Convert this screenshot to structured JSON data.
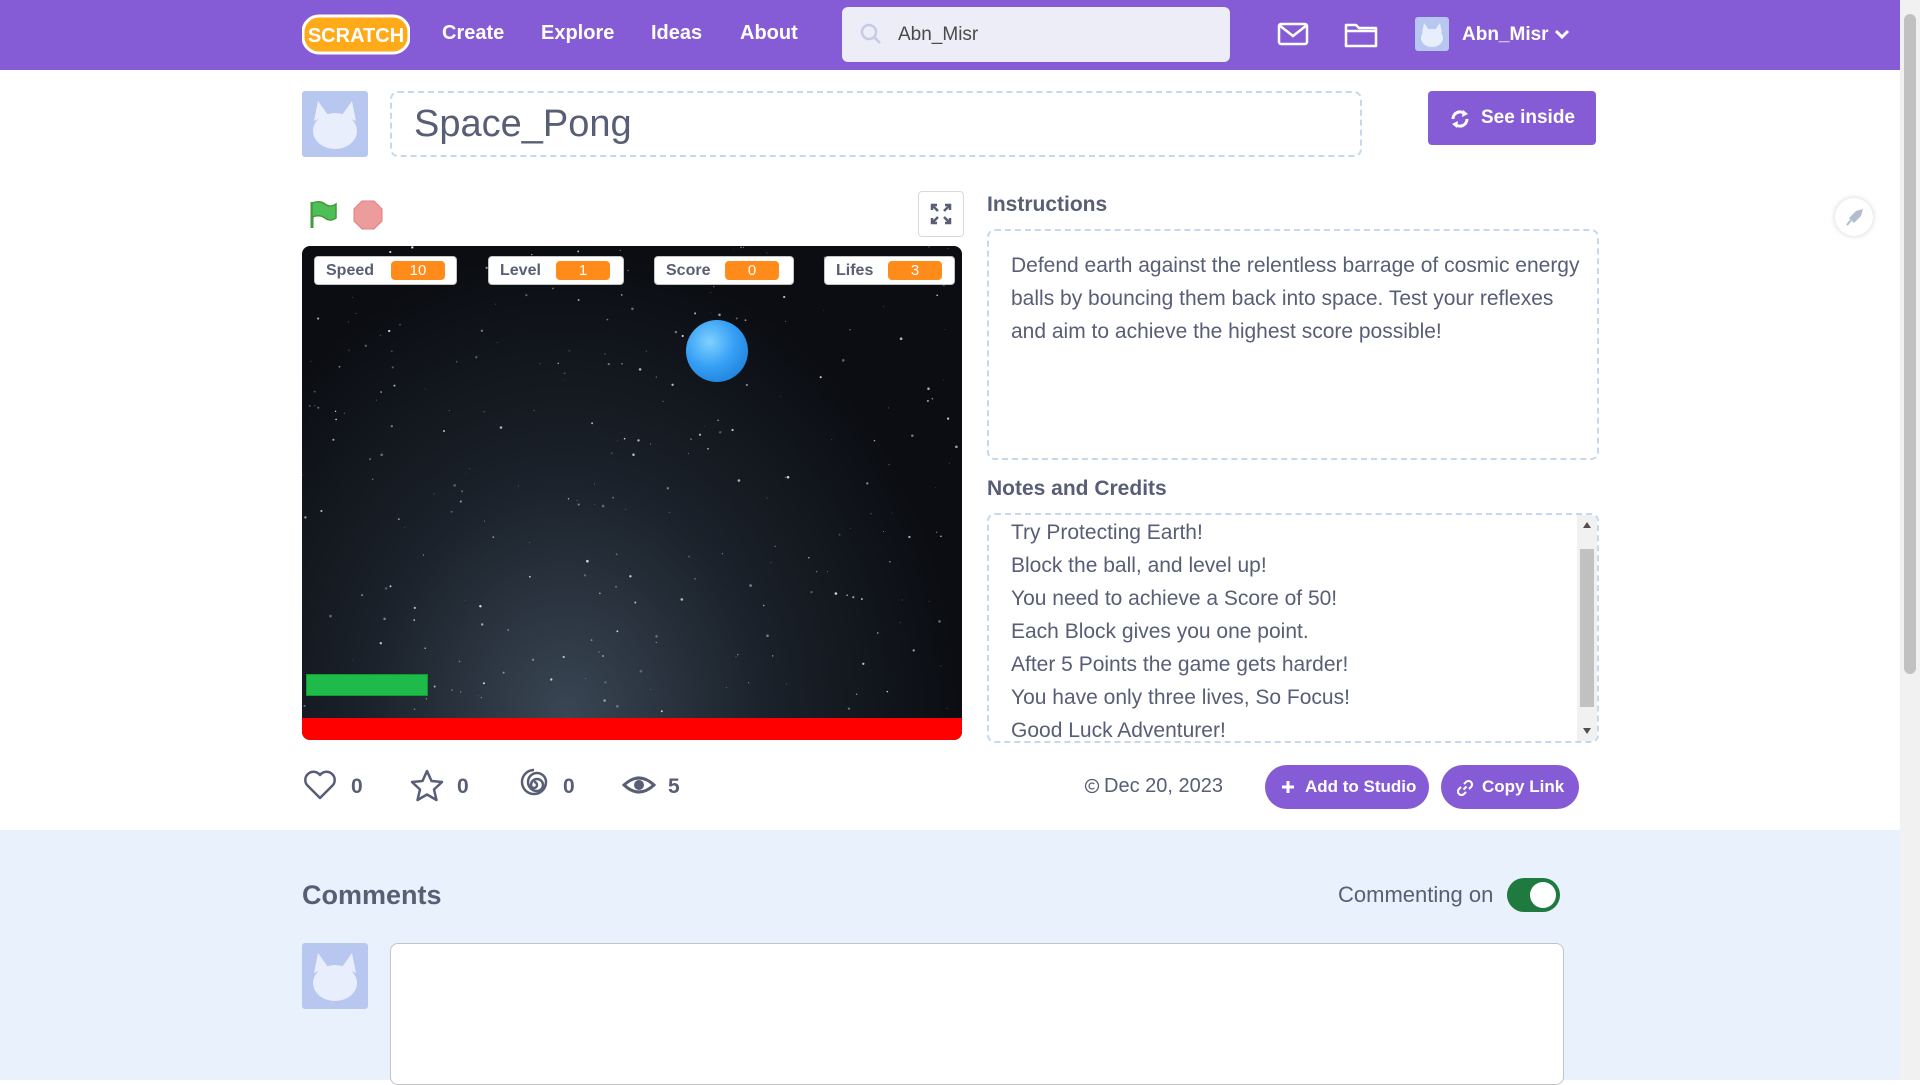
{
  "navbar": {
    "logo_text": "SCRATCH",
    "links": [
      "Create",
      "Explore",
      "Ideas",
      "About"
    ],
    "search_value": "Abn_Misr",
    "username": "Abn_Misr",
    "icons": [
      "search-icon",
      "messages-icon",
      "my-stuff-folder-icon",
      "chevron-down-icon"
    ]
  },
  "project": {
    "title": "Space_Pong",
    "see_inside_label": "See inside"
  },
  "stage": {
    "monitors": [
      {
        "label": "Speed",
        "value": "10"
      },
      {
        "label": "Level",
        "value": "1"
      },
      {
        "label": "Score",
        "value": "0"
      },
      {
        "label": "Lifes",
        "value": "3"
      }
    ]
  },
  "instructions": {
    "heading": "Instructions",
    "text": "Defend earth against the relentless barrage of cosmic energy balls by bouncing them back into space. Test your reflexes and aim to achieve the highest score possible!"
  },
  "notes": {
    "heading": "Notes and Credits",
    "lines": [
      "Try Protecting Earth!",
      "Block the ball, and level up!",
      "You need to achieve a Score of 50!",
      "Each Block gives you one point.",
      "After 5 Points the game gets harder!",
      "You have only three lives, So Focus!",
      "Good Luck Adventurer!"
    ]
  },
  "stats": {
    "loves": "0",
    "favorites": "0",
    "remixes": "0",
    "views": "5",
    "date": "Dec 20, 2023",
    "add_to_studio_label": "Add to Studio",
    "copy_link_label": "Copy Link"
  },
  "comments": {
    "heading": "Comments",
    "commenting_label": "Commenting on",
    "commenting_enabled": true
  },
  "colors": {
    "brand_purple": "#855cd6",
    "monitor_orange": "#ff8c1a",
    "toggle_green": "#1e7a3f",
    "text": "#575e75"
  }
}
